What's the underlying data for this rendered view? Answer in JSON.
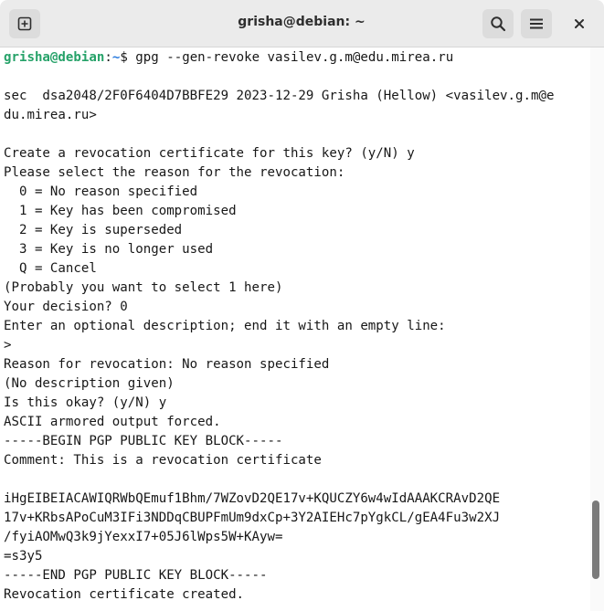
{
  "window": {
    "title": "grisha@debian: ~"
  },
  "titlebar": {
    "new_tab_icon": "new-tab-icon",
    "search_icon": "search-icon",
    "menu_icon": "hamburger-menu-icon",
    "close_icon": "close-icon"
  },
  "prompt": {
    "user": "grisha@debian",
    "sep": ":",
    "path": "~",
    "symbol": "$",
    "command": " gpg --gen-revoke vasilev.g.m@edu.mirea.ru"
  },
  "terminal_lines": [
    "sec  dsa2048/2F0F6404D7BBFE29 2023-12-29 Grisha (Hellow) <vasilev.g.m@e",
    "du.mirea.ru>",
    "Create a revocation certificate for this key? (y/N) y",
    "Please select the reason for the revocation:",
    "  0 = No reason specified",
    "  1 = Key has been compromised",
    "  2 = Key is superseded",
    "  3 = Key is no longer used",
    "  Q = Cancel",
    "(Probably you want to select 1 here)",
    "Your decision? 0",
    "Enter an optional description; end it with an empty line:",
    ">",
    "Reason for revocation: No reason specified",
    "(No description given)",
    "Is this okay? (y/N) y",
    "ASCII armored output forced.",
    "-----BEGIN PGP PUBLIC KEY BLOCK-----",
    "Comment: This is a revocation certificate",
    "iHgEIBEIACAWIQRWbQEmuf1Bhm/7WZovD2QE17v+KQUCZY6w4wIdAAAKCRAvD2QE",
    "17v+KRbsAPoCuM3IFi3NDDqCBUPFmUm9dxCp+3Y2AIEHc7pYgkCL/gEA4Fu3w2XJ",
    "/fyiAOMwQ3k9jYexxI7+05J6lWps5W+KAyw=",
    "=s3y5",
    "-----END PGP PUBLIC KEY BLOCK-----",
    "Revocation certificate created."
  ],
  "colors": {
    "user": "#26a269",
    "path": "#2a7bde",
    "text": "#171717",
    "titlebar": "#ebebeb"
  }
}
